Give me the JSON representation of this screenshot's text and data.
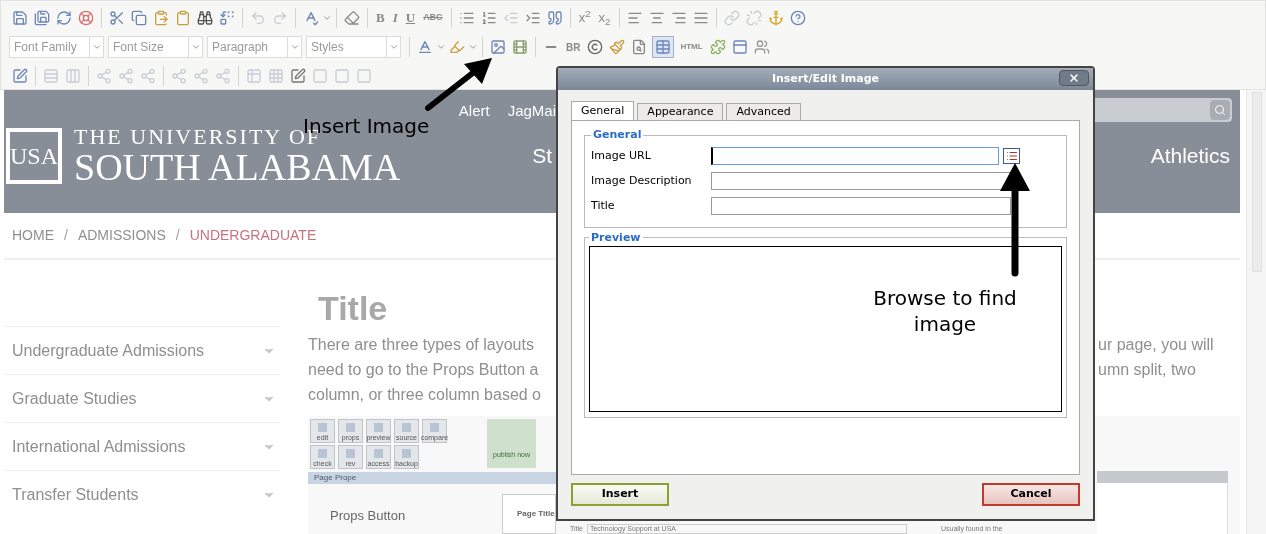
{
  "editor_toolbar": {
    "font_family": "Font Family",
    "font_size": "Font Size",
    "block_format": "Paragraph",
    "styles": "Styles",
    "format_buttons": [
      "B",
      "I",
      "U",
      "ABC"
    ],
    "script_buttons": [
      "x$^{2}$",
      "x$_{2}$"
    ],
    "break_button": "BR",
    "html_button": "HTML",
    "table_grid_selected": true
  },
  "site_header": {
    "logo_mark": "USA",
    "university_line": "THE UNIVERSITY OF",
    "name_line": "SOUTH ALABAMA",
    "top_links": [
      "Alert",
      "JagMai"
    ],
    "nav_left": "St",
    "nav_right": "Athletics"
  },
  "breadcrumb": [
    {
      "label": "HOME",
      "current": false
    },
    {
      "separator": "/",
      "label": "ADMISSIONS",
      "current": false
    },
    {
      "separator": "/",
      "label": "UNDERGRADUATE",
      "current": true
    }
  ],
  "sidebar": [
    "Undergraduate Admissions",
    "Graduate Studies",
    "International Admissions",
    "Transfer Students"
  ],
  "content": {
    "title": "Title",
    "paragraph_left": [
      "There are three types of layouts",
      "need to go to the Props Button a",
      "column, or three column based o"
    ],
    "paragraph_right": [
      "ur page, you will",
      "umn split, two"
    ]
  },
  "embedded_screenshot": {
    "buttons_top": [
      "edit",
      "props",
      "preview",
      "source",
      "compare"
    ],
    "buttons_bottom": [
      "check",
      "rev",
      "access",
      "backup"
    ],
    "publish": "publish now",
    "properties_bar": "Page Prope",
    "callout": "Props Button",
    "panel_title": "Page Title",
    "bottom_label": "Title",
    "bottom_field": "Technology Support at USA",
    "bottom_hint": "Usually found in the"
  },
  "dialog": {
    "title": "Insert/Edit Image",
    "tabs": [
      {
        "label": "General",
        "selected": true
      },
      {
        "label": "Appearance",
        "selected": false
      },
      {
        "label": "Advanced",
        "selected": false
      }
    ],
    "general_legend": "General",
    "fields": [
      {
        "label": "Image URL",
        "focused": true,
        "browse": true
      },
      {
        "label": "Image Description",
        "focused": false,
        "browse": false
      },
      {
        "label": "Title",
        "focused": false,
        "browse": false
      }
    ],
    "preview_legend": "Preview",
    "buttons": [
      {
        "label": "Insert",
        "kind": "confirm"
      },
      {
        "label": "Cancel",
        "kind": "cancel"
      }
    ]
  },
  "annotations": [
    {
      "kind": "toolbar",
      "text": "Insert Image"
    },
    {
      "kind": "browse",
      "text": "Browse to find image"
    }
  ]
}
